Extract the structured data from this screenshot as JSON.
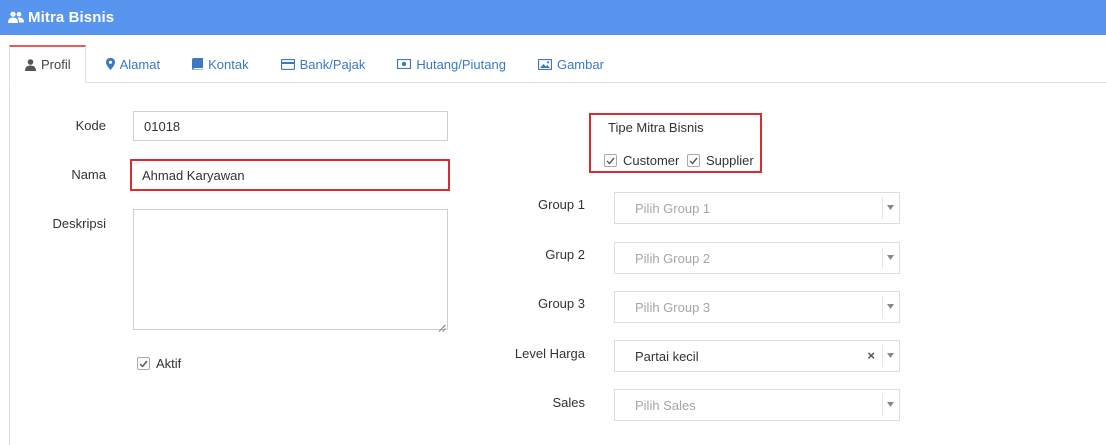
{
  "window": {
    "title": "Mitra Bisnis",
    "accent": "#5795ee",
    "title_icon": "users-icon"
  },
  "tabs": [
    {
      "label": "Profil",
      "icon": "user-icon",
      "active": true
    },
    {
      "label": "Alamat",
      "icon": "map-marker-icon"
    },
    {
      "label": "Kontak",
      "icon": "book-icon"
    },
    {
      "label": "Bank/Pajak",
      "icon": "credit-card-icon"
    },
    {
      "label": "Hutang/Piutang",
      "icon": "money-icon"
    },
    {
      "label": "Gambar",
      "icon": "picture-icon"
    }
  ],
  "form": {
    "kode": {
      "label": "Kode",
      "value": "01018"
    },
    "nama": {
      "label": "Nama",
      "value": "Ahmad Karyawan"
    },
    "deskripsi": {
      "label": "Deskripsi",
      "value": ""
    },
    "aktif": {
      "label": "Aktif",
      "checked": true
    }
  },
  "tipe": {
    "title": "Tipe Mitra Bisnis",
    "customer": {
      "label": "Customer",
      "checked": true
    },
    "supplier": {
      "label": "Supplier",
      "checked": true
    }
  },
  "selects": {
    "group1": {
      "label": "Group 1",
      "placeholder": "Pilih Group 1"
    },
    "group2": {
      "label": "Grup 2",
      "placeholder": "Pilih Group 2"
    },
    "group3": {
      "label": "Group 3",
      "placeholder": "Pilih Group 3"
    },
    "level_harga": {
      "label": "Level Harga",
      "value": "Partai kecil",
      "clear": "×"
    },
    "sales": {
      "label": "Sales",
      "placeholder": "Pilih Sales"
    }
  },
  "highlight_color": "#d92c2c"
}
